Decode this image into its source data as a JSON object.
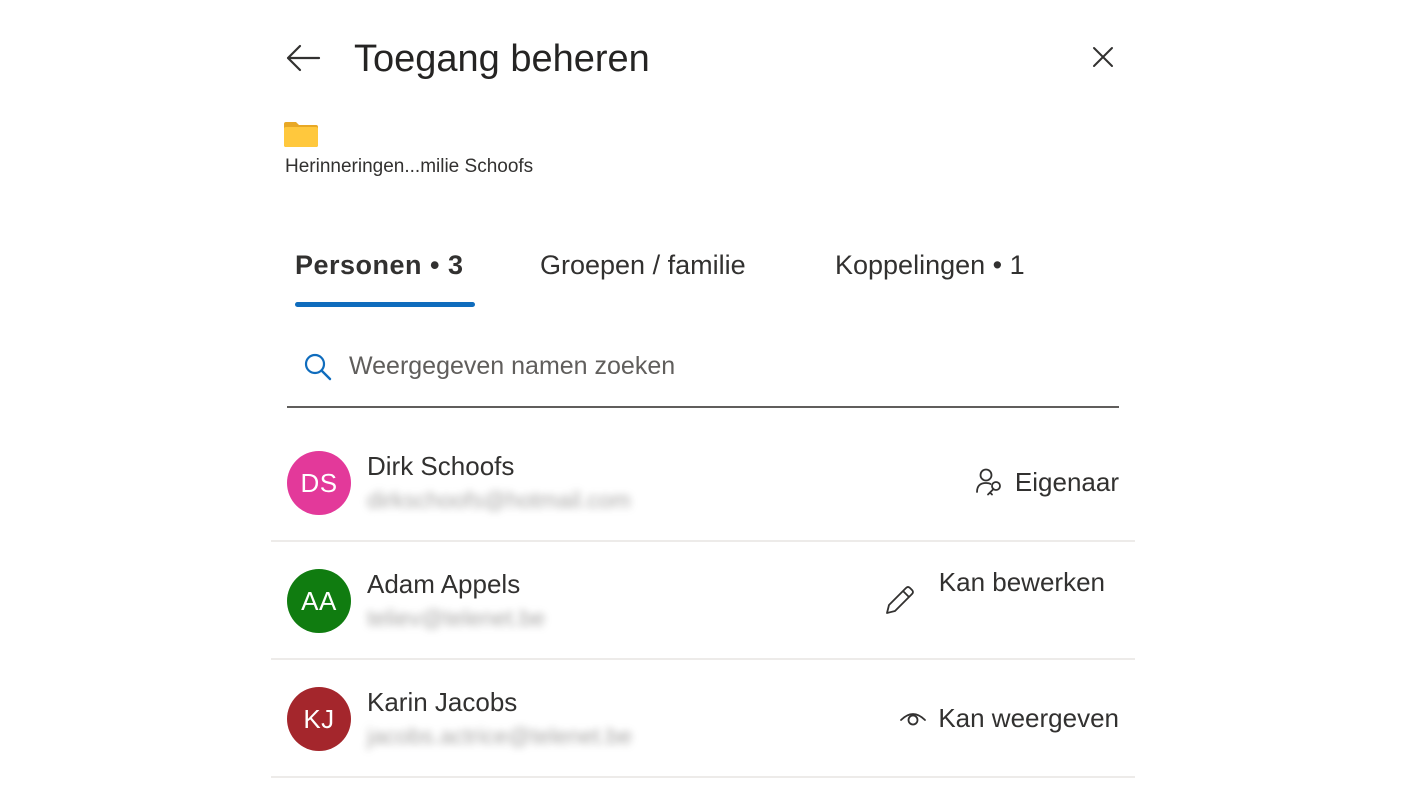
{
  "header": {
    "title": "Toegang beheren"
  },
  "item": {
    "name": "Herinneringen...milie Schoofs",
    "icon": "folder-icon",
    "folder_color": "#ffc83d"
  },
  "tabs": [
    {
      "label": "Personen • 3",
      "active": true
    },
    {
      "label": "Groepen / familie",
      "active": false
    },
    {
      "label": "Koppelingen • 1",
      "active": false
    }
  ],
  "accent_color": "#0f6cbd",
  "search": {
    "placeholder": "Weergegeven namen zoeken",
    "value": ""
  },
  "people": [
    {
      "initials": "DS",
      "name": "Dirk Schoofs",
      "email": "dirkschoofs@hotmail.com",
      "avatar_color": "#e3399a",
      "role": "Eigenaar",
      "role_icon": "owner-key-icon"
    },
    {
      "initials": "AA",
      "name": "Adam Appels",
      "email": "teliev@telenet.be",
      "avatar_color": "#107c10",
      "role": "Kan bewerken",
      "role_icon": "pencil-icon"
    },
    {
      "initials": "KJ",
      "name": "Karin Jacobs",
      "email": "jacobs.actrice@telenet.be",
      "avatar_color": "#a4262c",
      "role": "Kan weergeven",
      "role_icon": "eye-icon"
    }
  ]
}
